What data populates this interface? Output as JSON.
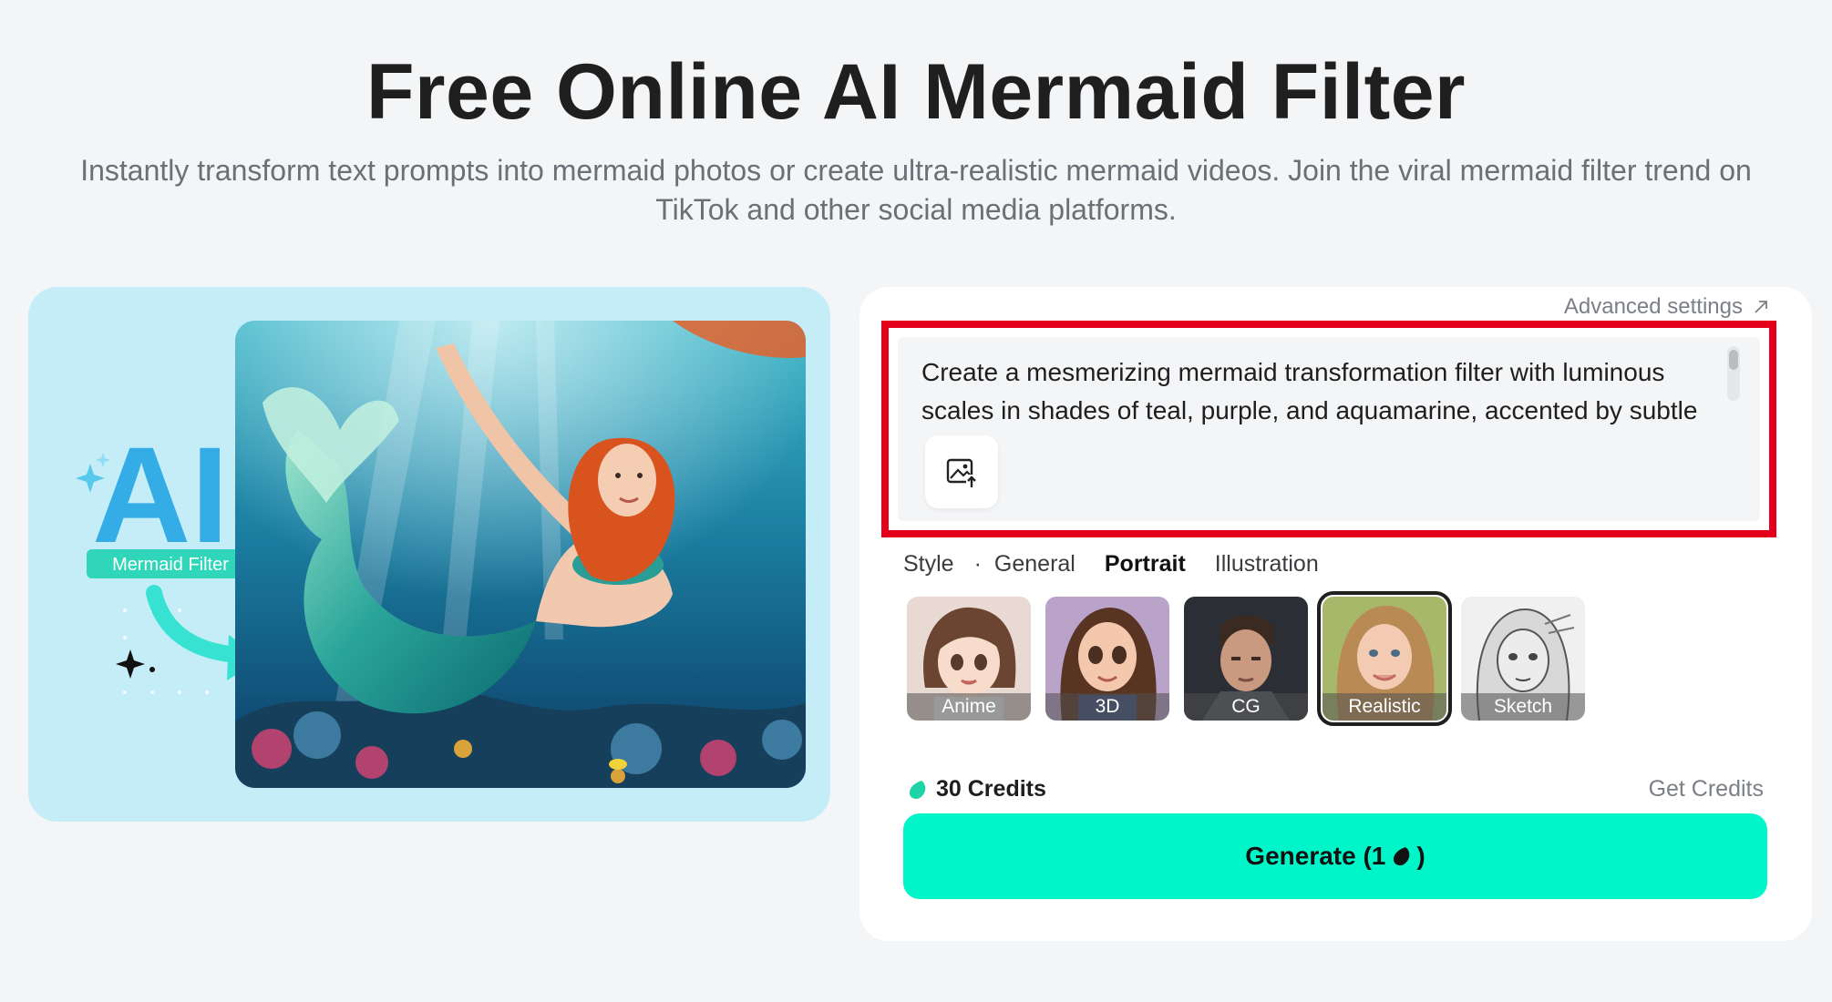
{
  "header": {
    "title": "Free Online AI Mermaid Filter",
    "subtitle": "Instantly transform text prompts into mermaid photos or create ultra-realistic mermaid videos. Join the viral mermaid filter trend on TikTok and other social media platforms."
  },
  "preview": {
    "badge_text": "AI",
    "badge_label": "Mermaid Filter",
    "image_alt": "mermaid-illustration"
  },
  "generator": {
    "advanced_settings_label": "Advanced settings",
    "prompt_text": "Create a mesmerizing mermaid transformation filter with luminous scales in shades of teal, purple, and aquamarine, accented by subtle",
    "style": {
      "label": "Style",
      "tabs": [
        {
          "label": "General",
          "active": false
        },
        {
          "label": "Portrait",
          "active": true
        },
        {
          "label": "Illustration",
          "active": false
        }
      ],
      "cards": [
        {
          "label": "Anime",
          "selected": false
        },
        {
          "label": "3D",
          "selected": false
        },
        {
          "label": "CG",
          "selected": false
        },
        {
          "label": "Realistic",
          "selected": true
        },
        {
          "label": "Sketch",
          "selected": false
        }
      ]
    },
    "credits_label": "30 Credits",
    "get_credits_label": "Get Credits",
    "generate_label_prefix": "Generate (1",
    "generate_label_suffix": ")"
  },
  "colors": {
    "accent": "#00f5c8",
    "highlight_border": "#e4001b",
    "preview_bg": "#c4edf7"
  },
  "icons": [
    "arrow-up-right-icon",
    "image-upload-icon",
    "credit-drop-icon",
    "sparkle-icon",
    "arrow-curve-icon"
  ]
}
